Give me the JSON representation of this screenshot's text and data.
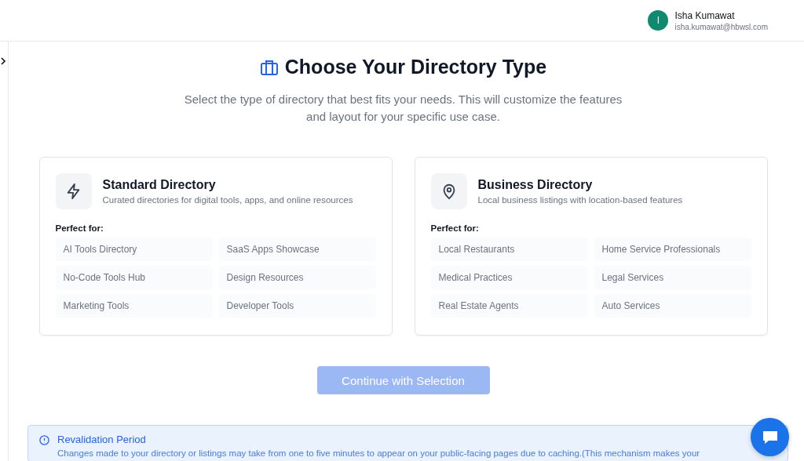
{
  "user": {
    "initial": "I",
    "name": "Isha Kumawat",
    "email": "isha.kumawat@hbwsl.com"
  },
  "sidebar": {
    "expanded": false
  },
  "heading": "Choose Your Directory Type",
  "subtitle": "Select the type of directory that best fits your needs. This will customize the features and layout for your specific use case.",
  "cards": [
    {
      "kind": "standard",
      "title": "Standard Directory",
      "description": "Curated directories for digital tools, apps, and online resources",
      "label": "Perfect for:",
      "examples": [
        "AI Tools Directory",
        "SaaS Apps Showcase",
        "No-Code Tools Hub",
        "Design Resources",
        "Marketing Tools",
        "Developer Tools"
      ]
    },
    {
      "kind": "business",
      "title": "Business Directory",
      "description": "Local business listings with location-based features",
      "label": "Perfect for:",
      "examples": [
        "Local Restaurants",
        "Home Service Professionals",
        "Medical Practices",
        "Legal Services",
        "Real Estate Agents",
        "Auto Services"
      ]
    }
  ],
  "continue_button": {
    "label": "Continue with Selection",
    "disabled": true
  },
  "notice": {
    "title": "Revalidation Period",
    "text": "Changes made to your directory or listings may take from one to five minutes to appear on your public-facing pages due to caching.(This mechanism makes your"
  }
}
